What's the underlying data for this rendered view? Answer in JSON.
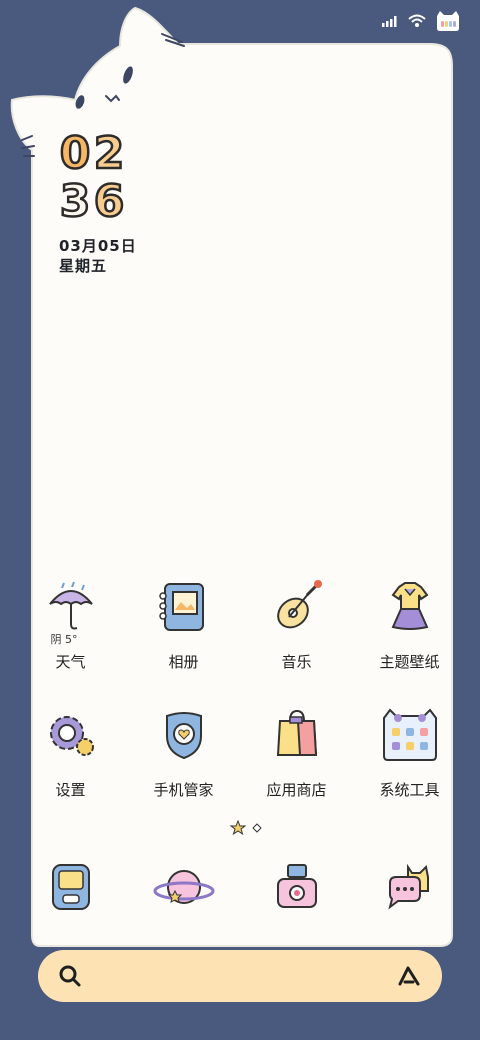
{
  "clock": {
    "hour_1": "0",
    "hour_2": "2",
    "minute_1": "3",
    "minute_2": "6"
  },
  "date": {
    "day": "03月05日",
    "weekday": "星期五"
  },
  "weather": {
    "summary": "阴 5°"
  },
  "apps": [
    {
      "label": "天气",
      "icon": "umbrella-icon"
    },
    {
      "label": "相册",
      "icon": "album-icon"
    },
    {
      "label": "音乐",
      "icon": "guitar-icon"
    },
    {
      "label": "主题壁纸",
      "icon": "dress-icon"
    },
    {
      "label": "设置",
      "icon": "gear-icon"
    },
    {
      "label": "手机管家",
      "icon": "shield-icon"
    },
    {
      "label": "应用商店",
      "icon": "shopping-bag-icon"
    },
    {
      "label": "系统工具",
      "icon": "folder-icon"
    }
  ],
  "dock": [
    {
      "icon": "phone-icon"
    },
    {
      "icon": "planet-icon"
    },
    {
      "icon": "camera-icon"
    },
    {
      "icon": "message-icon"
    }
  ],
  "colors": {
    "background": "#4a5a7e",
    "card": "#fdfcf8",
    "search_bar": "#fde3b3",
    "accent_orange": "#f5b766"
  }
}
